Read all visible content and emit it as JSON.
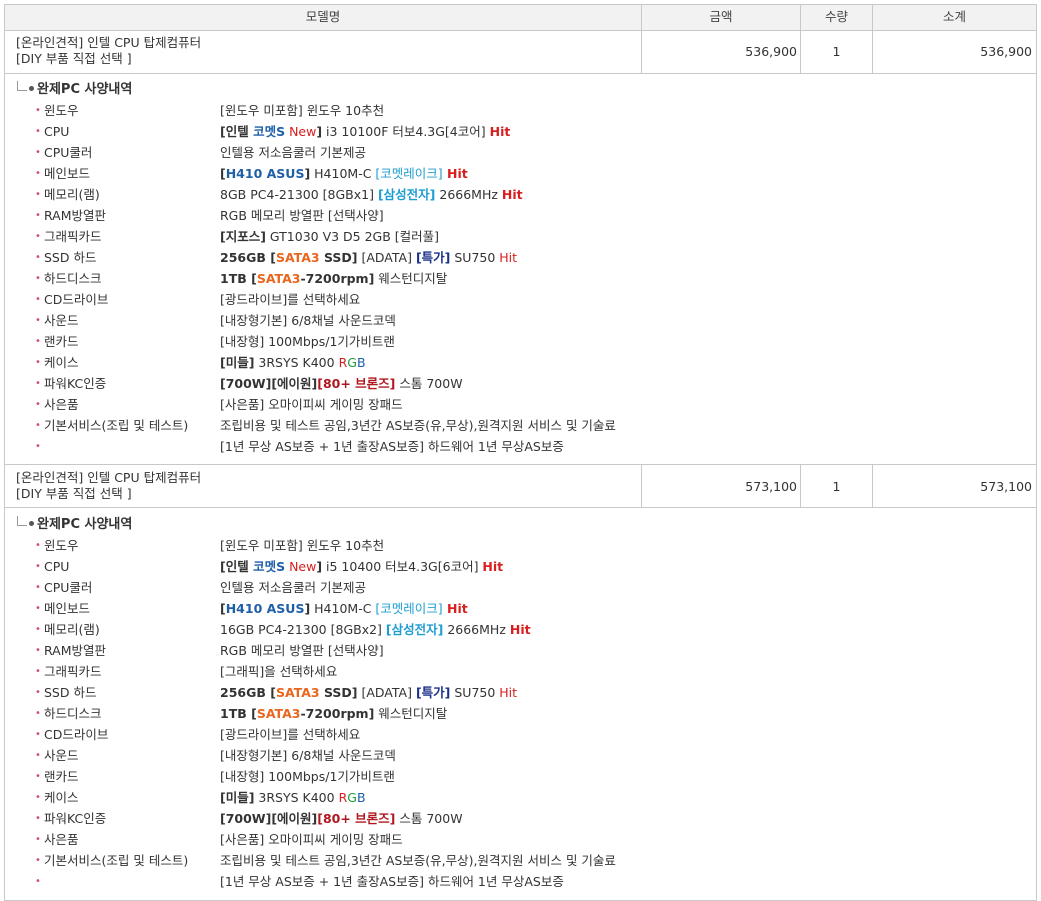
{
  "table": {
    "headers": {
      "model": "모델명",
      "price": "금액",
      "qty": "수량",
      "subtotal": "소계"
    }
  },
  "products": [
    {
      "name_line1": "[온라인견적] 인텔 CPU 탑제컴퓨터",
      "name_line2": "[DIY 부품 직접 선택 ]",
      "price": "536,900",
      "qty": "1",
      "subtotal": "536,900",
      "spec_title": "완제PC 사양내역",
      "specs": {
        "os": {
          "label": "윈도우",
          "value": "[윈도우 미포함] 윈도우 10추천"
        },
        "cpu": {
          "label": "CPU",
          "brand_open": "[",
          "brand_intel": "인텔 ",
          "brand_comet": "코멧S",
          "brand_new": " New",
          "brand_close": "]",
          "value": " i3 10100F 터보4.3G[4코어] ",
          "hit": "Hit"
        },
        "cooler": {
          "label": "CPU쿨러",
          "value": "인텔용 저소음쿨러 기본제공"
        },
        "board": {
          "label": "메인보드",
          "brand_open": "[",
          "brand": "H410 ASUS",
          "brand_close": "]",
          "model": " H410M-C ",
          "tag": "[코멧레이크]",
          "hit": " Hit"
        },
        "ram": {
          "label": "메모리(램)",
          "value": "8GB PC4-21300 [8GBx1] ",
          "brand": "[삼성전자]",
          "speed": " 2666MHz ",
          "hit": "Hit"
        },
        "ramcool": {
          "label": "RAM방열판",
          "value": "RGB 메모리 방열판 [선택사양]"
        },
        "gpu": {
          "label": "그래픽카드",
          "brand": "[지포스]",
          "value": " GT1030 V3 D5 2GB [컬러풀]"
        },
        "ssd": {
          "label": "SSD 하드",
          "cap": "256GB ",
          "sata_open": "[",
          "sata": "SATA3",
          "ssd_word": " SSD",
          "sata_close": "]",
          "maker": " [ADATA] ",
          "special": "[특가]",
          "model": " SU750 ",
          "hit": "Hit"
        },
        "hdd": {
          "label": "하드디스크",
          "cap": "1TB ",
          "sata_open": "[",
          "sata": "SATA3",
          "rpm": "-7200rpm",
          "sata_close": "]",
          "value": " 웨스턴디지탈"
        },
        "cd": {
          "label": "CD드라이브",
          "value": "[광드라이브]를 선택하세요"
        },
        "sound": {
          "label": "사운드",
          "value": "[내장형기본] 6/8채널 사운드코덱"
        },
        "lan": {
          "label": "랜카드",
          "value": "[내장형] 100Mbps/1기가비트랜"
        },
        "case": {
          "label": "케이스",
          "brand": "[미들]",
          "value": " 3RSYS K400 ",
          "r": "R",
          "g": "G",
          "bb": "B"
        },
        "power": {
          "label": "파워KC인증",
          "watt": "[700W]",
          "maker": "[에이원]",
          "grade": "[80+ 브론즈]",
          "value": " 스톰 700W"
        },
        "gift": {
          "label": "사은품",
          "value": "[사은품] 오마이피씨 게이밍 장패드"
        },
        "service": {
          "label": "기본서비스(조립 및 테스트)",
          "value": "조립비용 및 테스트 공임,3년간 AS보증(유,무상),원격지원 서비스 및 기술료"
        },
        "warranty": {
          "label": "",
          "value": "[1년 무상 AS보증 + 1년 출장AS보증] 하드웨어 1년 무상AS보증"
        }
      }
    },
    {
      "name_line1": "[온라인견적] 인텔 CPU 탑제컴퓨터",
      "name_line2": "[DIY 부품 직접 선택 ]",
      "price": "573,100",
      "qty": "1",
      "subtotal": "573,100",
      "spec_title": "완제PC 사양내역",
      "specs": {
        "os": {
          "label": "윈도우",
          "value": "[윈도우 미포함] 윈도우 10추천"
        },
        "cpu": {
          "label": "CPU",
          "brand_open": "[",
          "brand_intel": "인텔 ",
          "brand_comet": "코멧S",
          "brand_new": " New",
          "brand_close": "]",
          "value": " i5 10400 터보4.3G[6코어] ",
          "hit": "Hit"
        },
        "cooler": {
          "label": "CPU쿨러",
          "value": "인텔용 저소음쿨러 기본제공"
        },
        "board": {
          "label": "메인보드",
          "brand_open": "[",
          "brand": "H410 ASUS",
          "brand_close": "]",
          "model": " H410M-C ",
          "tag": "[코멧레이크]",
          "hit": " Hit"
        },
        "ram": {
          "label": "메모리(램)",
          "value": "16GB PC4-21300 [8GBx2] ",
          "brand": "[삼성전자]",
          "speed": " 2666MHz ",
          "hit": "Hit"
        },
        "ramcool": {
          "label": "RAM방열판",
          "value": "RGB 메모리 방열판 [선택사양]"
        },
        "gpu": {
          "label": "그래픽카드",
          "brand": "",
          "value": "[그래픽]을 선택하세요"
        },
        "ssd": {
          "label": "SSD 하드",
          "cap": "256GB ",
          "sata_open": "[",
          "sata": "SATA3",
          "ssd_word": " SSD",
          "sata_close": "]",
          "maker": " [ADATA] ",
          "special": "[특가]",
          "model": " SU750 ",
          "hit": "Hit"
        },
        "hdd": {
          "label": "하드디스크",
          "cap": "1TB ",
          "sata_open": "[",
          "sata": "SATA3",
          "rpm": "-7200rpm",
          "sata_close": "]",
          "value": " 웨스턴디지탈"
        },
        "cd": {
          "label": "CD드라이브",
          "value": "[광드라이브]를 선택하세요"
        },
        "sound": {
          "label": "사운드",
          "value": "[내장형기본] 6/8채널 사운드코덱"
        },
        "lan": {
          "label": "랜카드",
          "value": "[내장형] 100Mbps/1기가비트랜"
        },
        "case": {
          "label": "케이스",
          "brand": "[미들]",
          "value": " 3RSYS K400 ",
          "r": "R",
          "g": "G",
          "bb": "B"
        },
        "power": {
          "label": "파워KC인증",
          "watt": "[700W]",
          "maker": "[에이원]",
          "grade": "[80+ 브론즈]",
          "value": " 스톰 700W"
        },
        "gift": {
          "label": "사은품",
          "value": "[사은품] 오마이피씨 게이밍 장패드"
        },
        "service": {
          "label": "기본서비스(조립 및 테스트)",
          "value": "조립비용 및 테스트 공임,3년간 AS보증(유,무상),원격지원 서비스 및 기술료"
        },
        "warranty": {
          "label": "",
          "value": "[1년 무상 AS보증 + 1년 출장AS보증] 하드웨어 1년 무상AS보증"
        }
      }
    }
  ],
  "colors": {
    "border": "#c8c8c8",
    "header_bg": "#f2f2f2",
    "bold_blue": "#1f5fa8",
    "accent_cyan": "#1e9dd0",
    "accent_orange": "#e8661e",
    "hit_red": "#d81e1e",
    "power_red": "#b0171f",
    "special_navy": "#1a2f8a"
  },
  "icons": {
    "bullet": "dot-bullet-icon",
    "tree": "tree-connector-icon"
  }
}
